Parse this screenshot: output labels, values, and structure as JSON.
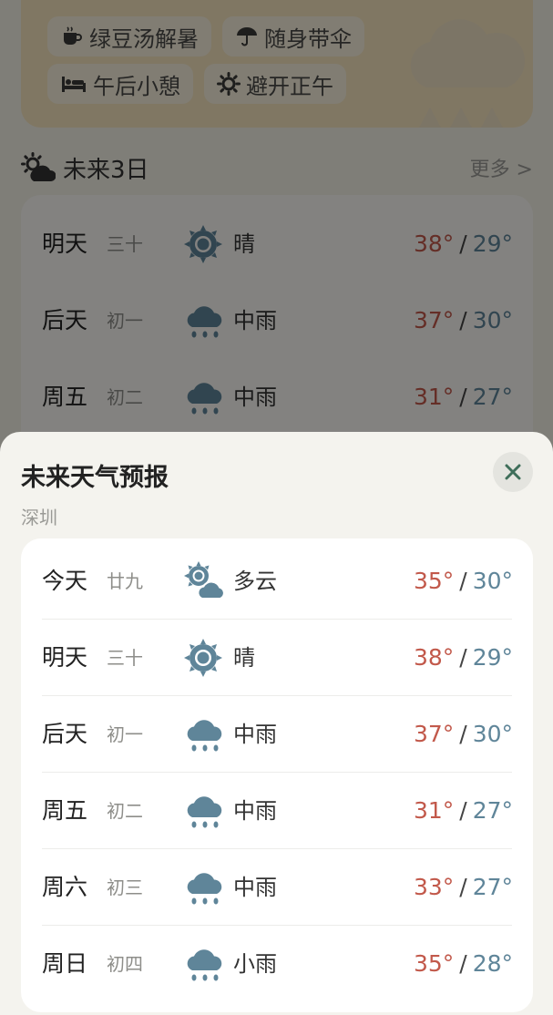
{
  "tips": [
    "绿豆汤解暑",
    "随身带伞",
    "午后小憩",
    "避开正午"
  ],
  "section": {
    "title": "未来3日",
    "more": "更多 >"
  },
  "preview_rows": [
    {
      "day": "明天",
      "lunar": "三十",
      "icon": "sun-icon",
      "condition": "晴",
      "high": "38°",
      "low": "29°"
    },
    {
      "day": "后天",
      "lunar": "初一",
      "icon": "rain-icon",
      "condition": "中雨",
      "high": "37°",
      "low": "30°"
    },
    {
      "day": "周五",
      "lunar": "初二",
      "icon": "rain-icon",
      "condition": "中雨",
      "high": "31°",
      "low": "27°"
    }
  ],
  "sheet": {
    "title": "未来天气预报",
    "city": "深圳"
  },
  "forecast": [
    {
      "day": "今天",
      "lunar": "廿九",
      "icon": "partly-cloudy-icon",
      "condition": "多云",
      "high": "35°",
      "low": "30°"
    },
    {
      "day": "明天",
      "lunar": "三十",
      "icon": "sun-icon",
      "condition": "晴",
      "high": "38°",
      "low": "29°"
    },
    {
      "day": "后天",
      "lunar": "初一",
      "icon": "rain-icon",
      "condition": "中雨",
      "high": "37°",
      "low": "30°"
    },
    {
      "day": "周五",
      "lunar": "初二",
      "icon": "rain-icon",
      "condition": "中雨",
      "high": "31°",
      "low": "27°"
    },
    {
      "day": "周六",
      "lunar": "初三",
      "icon": "rain-icon",
      "condition": "中雨",
      "high": "33°",
      "low": "27°"
    },
    {
      "day": "周日",
      "lunar": "初四",
      "icon": "rain-icon",
      "condition": "小雨",
      "high": "35°",
      "low": "28°"
    }
  ],
  "colors": {
    "high_temp": "#c2594b",
    "low_temp": "#5f8599",
    "icon_blue": "#5f8599",
    "close_icon": "#3f6e5a"
  }
}
